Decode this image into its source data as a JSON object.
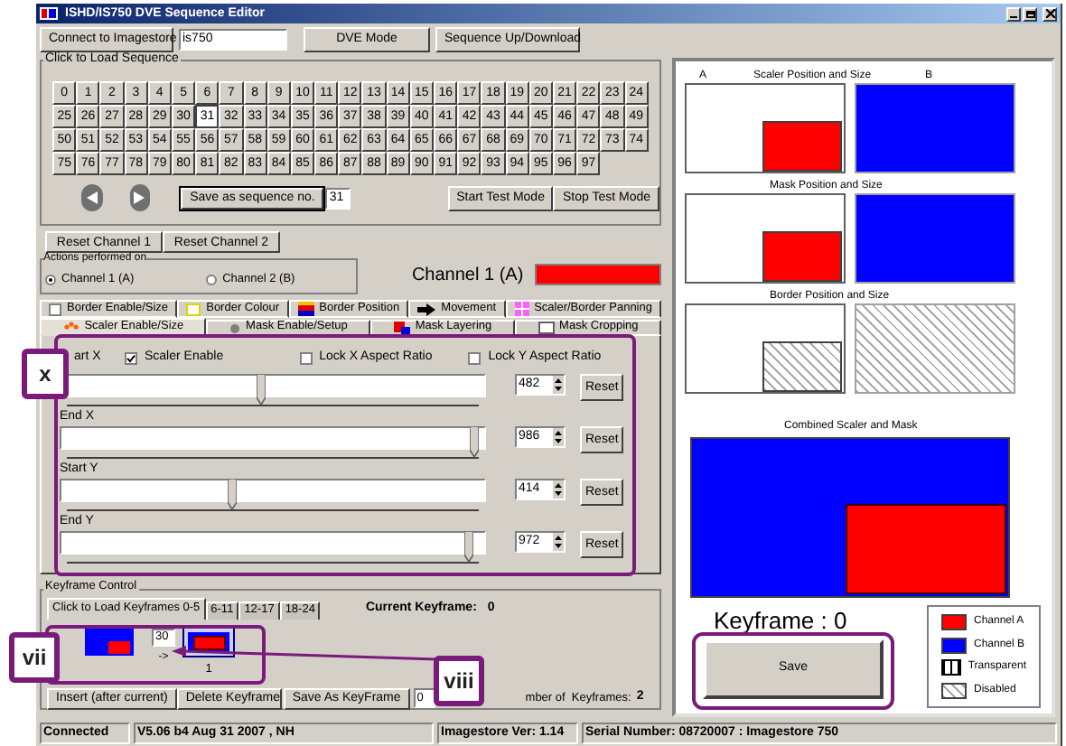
{
  "window": {
    "title": "ISHD/IS750 DVE Sequence Editor"
  },
  "toolbar": {
    "connect_button": "Connect to Imagestore",
    "host_field": "is750",
    "mode_button": "DVE Mode",
    "transfer_button": "Sequence Up/Download"
  },
  "sequences": {
    "label": "Click to Load Sequence",
    "items": [
      {
        "label": "0",
        "selected": false
      },
      {
        "label": "1",
        "selected": false
      },
      {
        "label": "2",
        "selected": false
      },
      {
        "label": "3",
        "selected": false
      },
      {
        "label": "4",
        "selected": false
      },
      {
        "label": "5",
        "selected": false
      },
      {
        "label": "6",
        "selected": false
      },
      {
        "label": "7",
        "selected": false
      },
      {
        "label": "8",
        "selected": false
      },
      {
        "label": "9",
        "selected": false
      },
      {
        "label": "10",
        "selected": false
      },
      {
        "label": "11",
        "selected": false
      },
      {
        "label": "12",
        "selected": false
      },
      {
        "label": "13",
        "selected": false
      },
      {
        "label": "14",
        "selected": false
      },
      {
        "label": "15",
        "selected": false
      },
      {
        "label": "16",
        "selected": false
      },
      {
        "label": "17",
        "selected": false
      },
      {
        "label": "18",
        "selected": false
      },
      {
        "label": "19",
        "selected": false
      },
      {
        "label": "20",
        "selected": false
      },
      {
        "label": "21",
        "selected": false
      },
      {
        "label": "22",
        "selected": false
      },
      {
        "label": "23",
        "selected": false
      },
      {
        "label": "24",
        "selected": false
      },
      {
        "label": "25",
        "selected": false
      },
      {
        "label": "26",
        "selected": false
      },
      {
        "label": "27",
        "selected": false
      },
      {
        "label": "28",
        "selected": false
      },
      {
        "label": "29",
        "selected": false
      },
      {
        "label": "30",
        "selected": false
      },
      {
        "label": "31",
        "selected": true
      },
      {
        "label": "32",
        "selected": false
      },
      {
        "label": "33",
        "selected": false
      },
      {
        "label": "34",
        "selected": false
      },
      {
        "label": "35",
        "selected": false
      },
      {
        "label": "36",
        "selected": false
      },
      {
        "label": "37",
        "selected": false
      },
      {
        "label": "38",
        "selected": false
      },
      {
        "label": "39",
        "selected": false
      },
      {
        "label": "40",
        "selected": false
      },
      {
        "label": "41",
        "selected": false
      },
      {
        "label": "42",
        "selected": false
      },
      {
        "label": "43",
        "selected": false
      },
      {
        "label": "44",
        "selected": false
      },
      {
        "label": "45",
        "selected": false
      },
      {
        "label": "46",
        "selected": false
      },
      {
        "label": "47",
        "selected": false
      },
      {
        "label": "48",
        "selected": false
      },
      {
        "label": "49",
        "selected": false
      },
      {
        "label": "50",
        "selected": false
      },
      {
        "label": "51",
        "selected": false
      },
      {
        "label": "52",
        "selected": false
      },
      {
        "label": "53",
        "selected": false
      },
      {
        "label": "54",
        "selected": false
      },
      {
        "label": "55",
        "selected": false
      },
      {
        "label": "56",
        "selected": false
      },
      {
        "label": "57",
        "selected": false
      },
      {
        "label": "58",
        "selected": false
      },
      {
        "label": "59",
        "selected": false
      },
      {
        "label": "60",
        "selected": false
      },
      {
        "label": "61",
        "selected": false
      },
      {
        "label": "62",
        "selected": false
      },
      {
        "label": "63",
        "selected": false
      },
      {
        "label": "64",
        "selected": false
      },
      {
        "label": "65",
        "selected": false
      },
      {
        "label": "66",
        "selected": false
      },
      {
        "label": "67",
        "selected": false
      },
      {
        "label": "68",
        "selected": false
      },
      {
        "label": "69",
        "selected": false
      },
      {
        "label": "70",
        "selected": false
      },
      {
        "label": "71",
        "selected": false
      },
      {
        "label": "72",
        "selected": false
      },
      {
        "label": "73",
        "selected": false
      },
      {
        "label": "74",
        "selected": false
      },
      {
        "label": "75",
        "selected": false
      },
      {
        "label": "76",
        "selected": false
      },
      {
        "label": "77",
        "selected": false
      },
      {
        "label": "78",
        "selected": false
      },
      {
        "label": "79",
        "selected": false
      },
      {
        "label": "80",
        "selected": false
      },
      {
        "label": "81",
        "selected": false
      },
      {
        "label": "82",
        "selected": false
      },
      {
        "label": "83",
        "selected": false
      },
      {
        "label": "84",
        "selected": false
      },
      {
        "label": "85",
        "selected": false
      },
      {
        "label": "86",
        "selected": false
      },
      {
        "label": "87",
        "selected": false
      },
      {
        "label": "88",
        "selected": false
      },
      {
        "label": "89",
        "selected": false
      },
      {
        "label": "90",
        "selected": false
      },
      {
        "label": "91",
        "selected": false
      },
      {
        "label": "92",
        "selected": false
      },
      {
        "label": "93",
        "selected": false
      },
      {
        "label": "94",
        "selected": false
      },
      {
        "label": "95",
        "selected": false
      },
      {
        "label": "96",
        "selected": false
      },
      {
        "label": "97",
        "selected": false
      }
    ]
  },
  "sequence_controls": {
    "save_button": "Save as sequence no.",
    "save_field": "31",
    "start_test": "Start Test Mode",
    "stop_test": "Stop Test Mode"
  },
  "reset_buttons": [
    "Reset Channel 1",
    "Reset Channel 2"
  ],
  "actions": {
    "label": "Actions performed on",
    "options": [
      {
        "label": "Channel 1 (A)",
        "selected": true
      },
      {
        "label": "Channel 2 (B)",
        "selected": false
      }
    ],
    "channel_title": "Channel 1 (A)"
  },
  "tabs_row_1": [
    {
      "label": "Border Enable/Size",
      "kind": "checkbox"
    },
    {
      "label": "Border Colour",
      "kind": "colour"
    },
    {
      "label": "Border Position",
      "kind": "position"
    },
    {
      "label": "Movement",
      "kind": "movement"
    },
    {
      "label": "Scaler/Border Panning",
      "kind": "panning"
    }
  ],
  "tabs_row_2": [
    {
      "label": "Scaler Enable/Size",
      "kind": "scaler",
      "selected": true
    },
    {
      "label": "Mask Enable/Setup",
      "kind": "mask",
      "selected": false
    },
    {
      "label": "Mask Layering",
      "kind": "layering",
      "selected": false
    },
    {
      "label": "Mask Cropping",
      "kind": "cropping",
      "selected": false
    }
  ],
  "scaler": {
    "checks": [
      {
        "label": "Scaler Enable",
        "checked": true
      },
      {
        "label": "Lock X Aspect Ratio",
        "checked": false
      },
      {
        "label": "Lock Y Aspect Ratio",
        "checked": false
      }
    ],
    "sliders": [
      {
        "label": "art X",
        "level": 0.48,
        "value": "482",
        "reset": "Reset"
      },
      {
        "label": "End X",
        "level": 0.985,
        "value": "986",
        "reset": "Reset"
      },
      {
        "label": "Start Y",
        "level": 0.41,
        "value": "414",
        "reset": "Reset"
      },
      {
        "label": "End Y",
        "level": 0.97,
        "value": "972",
        "reset": "Reset"
      }
    ]
  },
  "keyframes": {
    "label": "Keyframe Control",
    "tabs": [
      {
        "label": "Click to Load Keyframes 0-5",
        "selected": true
      },
      {
        "label": "6-11",
        "selected": false
      },
      {
        "label": "12-17",
        "selected": false
      },
      {
        "label": "18-24",
        "selected": false
      }
    ],
    "current_label": "Current Keyframe:",
    "current_value": "0",
    "frames": [
      {
        "selected": false
      },
      {
        "selected": true
      }
    ],
    "duration": "30",
    "arrow": "->",
    "next_number": "1",
    "buttons": [
      "Insert (after current)",
      "Delete Keyframe",
      "Save As KeyFrame"
    ],
    "keyframe_field": "0",
    "count_label": "mber of  Keyframes:",
    "count": "2"
  },
  "preview": {
    "col_a": "A",
    "col_b": "B",
    "sections": [
      {
        "title": "Scaler Position and Size",
        "kind": "fill"
      },
      {
        "title": "Mask Position and Size",
        "kind": "fill"
      },
      {
        "title": "Border Position and Size",
        "kind": "hatch"
      }
    ],
    "combined_label": "Combined Scaler and Mask",
    "keyframe_label": "Keyframe : 0",
    "save_button": "Save",
    "legend": [
      {
        "label": "Channel A",
        "kind": "fill",
        "color": "#ff0000"
      },
      {
        "label": "Channel B",
        "kind": "fill",
        "color": "#0000ff"
      },
      {
        "label": "Transparent",
        "kind": "grid"
      },
      {
        "label": "Disabled",
        "kind": "hatch"
      }
    ]
  },
  "annotations": [
    {
      "label": "x"
    },
    {
      "label": "vii"
    },
    {
      "label": "viii"
    }
  ],
  "status_bar": [
    "Connected",
    "V5.06 b4  Aug 31 2007 , NH",
    "Imagestore Ver: 1.14",
    "Serial Number: 08720007 : Imagestore 750"
  ]
}
